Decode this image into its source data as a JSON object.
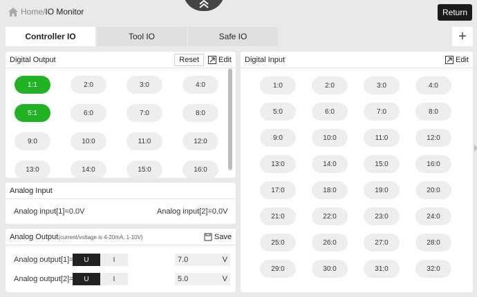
{
  "header": {
    "home_label": "Home",
    "separator": "/",
    "page_title": "IO Monitor",
    "return_label": "Return"
  },
  "tabs": [
    {
      "label": "Controller IO",
      "active": true
    },
    {
      "label": "Tool IO",
      "active": false
    },
    {
      "label": "Safe IO",
      "active": false
    }
  ],
  "digital_output": {
    "title": "Digital Output",
    "reset_label": "Reset",
    "edit_label": "Edit",
    "items": [
      "1:1",
      "2:0",
      "3:0",
      "4:0",
      "5:1",
      "6:0",
      "7:0",
      "8:0",
      "9:0",
      "10:0",
      "11:0",
      "12:0",
      "13:0",
      "14:0",
      "15:0",
      "16:0"
    ]
  },
  "analog_input": {
    "title": "Analog Input",
    "input1": "Analog input[1]=0.0V",
    "input2": "Analog input[2]=0.0V"
  },
  "analog_output": {
    "title": "Analog Output",
    "note": "(current/voltage is 4-20mA, 1-10V)",
    "save_label": "Save",
    "rows": [
      {
        "label": "Analog output[1]=",
        "mode_u": "U",
        "mode_i": "I",
        "value": "7.0",
        "unit": "V",
        "selected": "U"
      },
      {
        "label": "Analog output[2]=",
        "mode_u": "U",
        "mode_i": "I",
        "value": "5.0",
        "unit": "V",
        "selected": "U"
      }
    ]
  },
  "digital_input": {
    "title": "Digital Input",
    "edit_label": "Edit",
    "items": [
      "1:0",
      "2:0",
      "3:0",
      "4:0",
      "5:0",
      "6:0",
      "7:0",
      "8:0",
      "9:0",
      "10:0",
      "11:0",
      "12:0",
      "13:0",
      "14:0",
      "15:0",
      "16:0",
      "17:0",
      "18:0",
      "19:0",
      "20:0",
      "21:0",
      "22:0",
      "23:0",
      "24:0",
      "25:0",
      "26:0",
      "27:0",
      "28:0",
      "29:0",
      "30:0",
      "31:0",
      "32:0"
    ]
  },
  "colors": {
    "on": "#21b324",
    "off": "#eeeeee",
    "dark": "#222222"
  }
}
